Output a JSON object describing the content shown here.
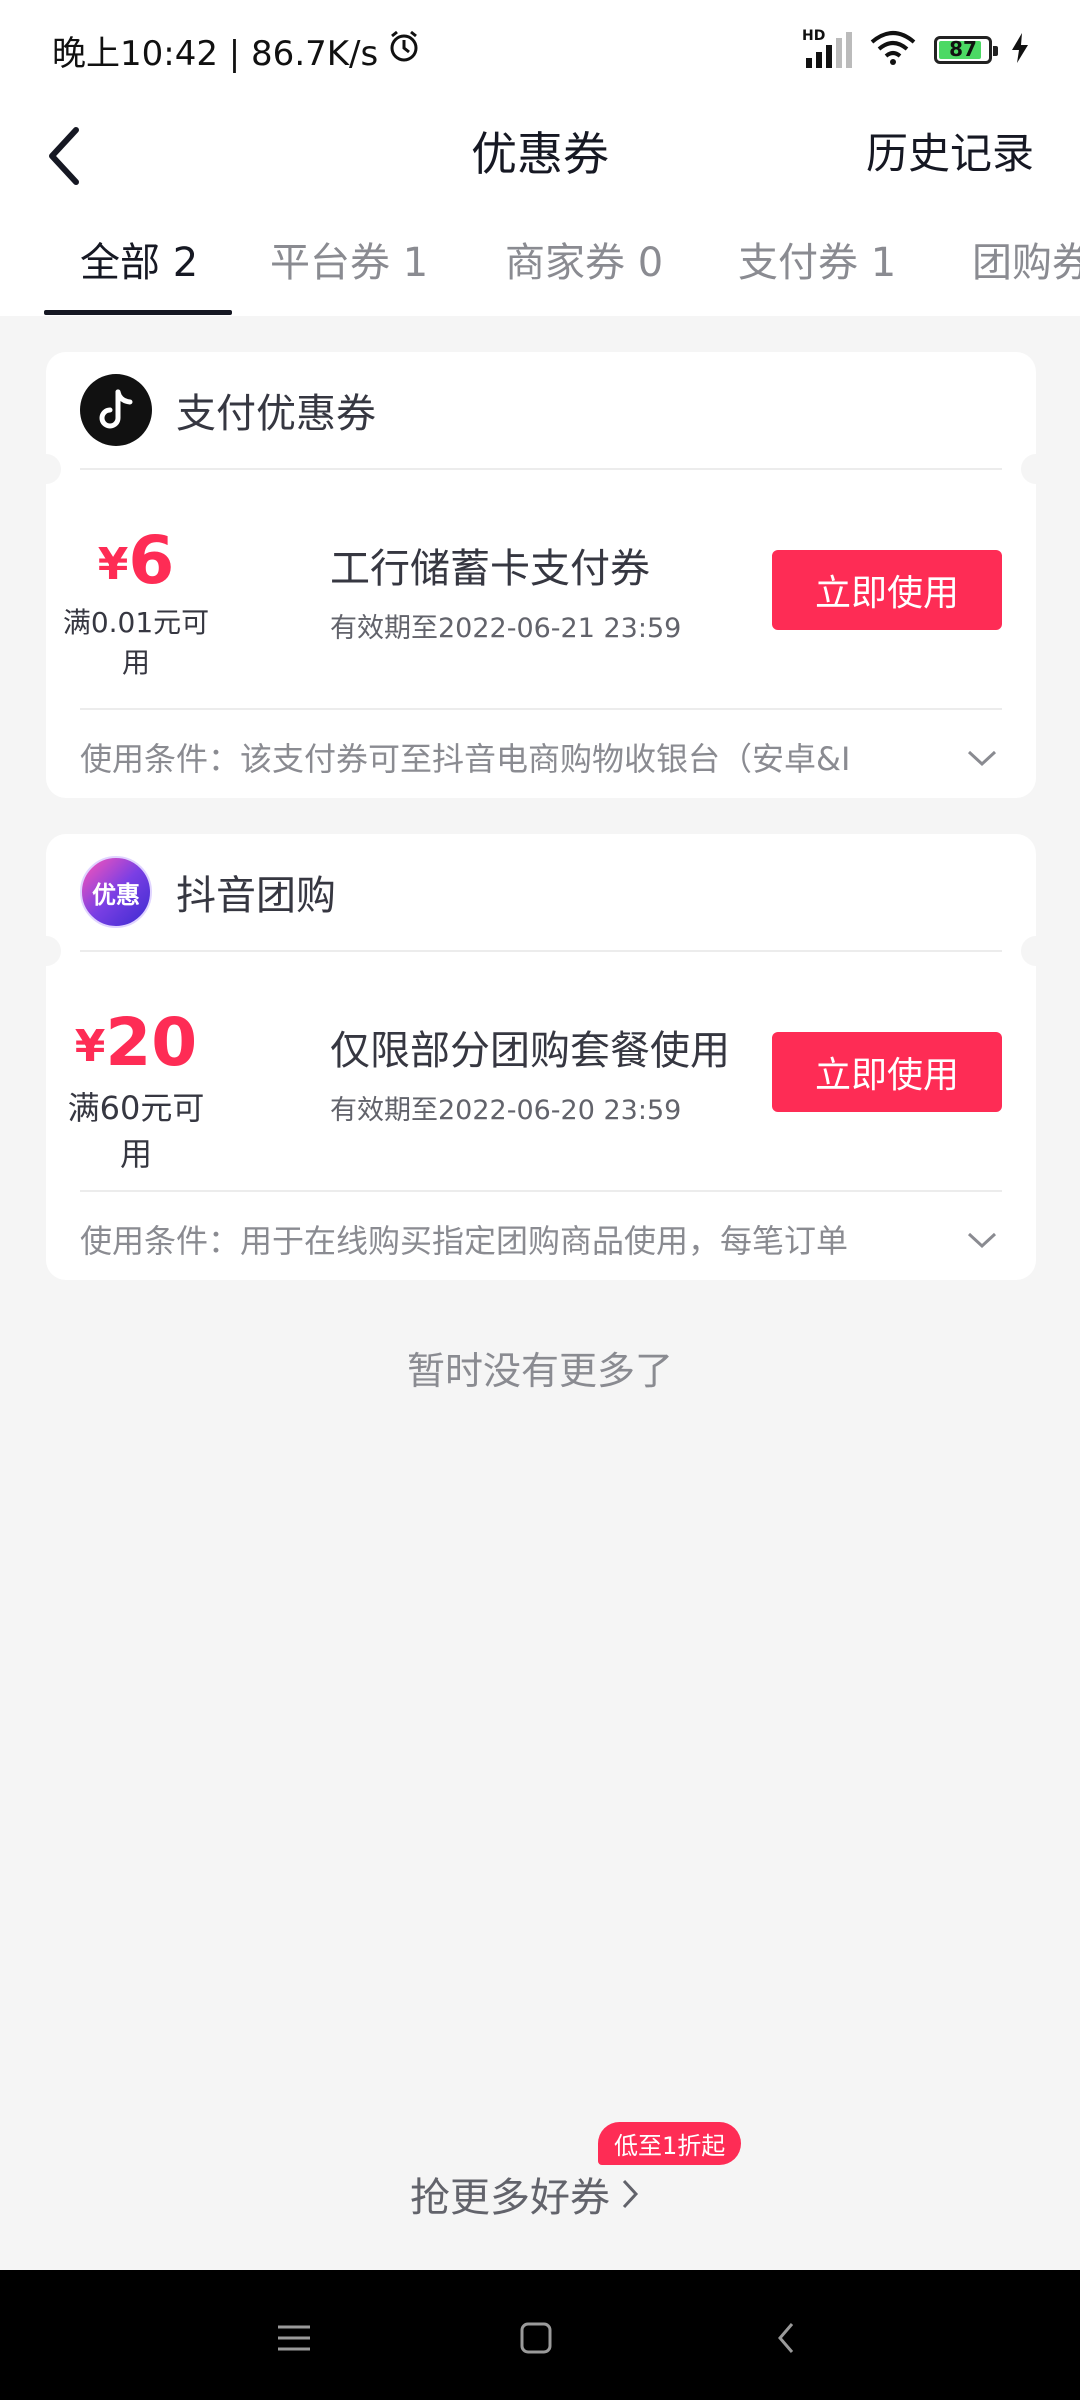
{
  "status_bar": {
    "time_text": "晚上10:42 | 86.7K/s",
    "network_label": "HD",
    "battery_level": "87"
  },
  "header": {
    "title": "优惠券",
    "history_label": "历史记录"
  },
  "tabs": [
    {
      "label": "全部 2",
      "active": true
    },
    {
      "label": "平台券 1",
      "active": false
    },
    {
      "label": "商家券 0",
      "active": false
    },
    {
      "label": "支付券 1",
      "active": false
    },
    {
      "label": "团购券",
      "active": false
    }
  ],
  "coupons": [
    {
      "section_title": "支付优惠券",
      "logo_icon": "douyin-logo-icon",
      "currency": "¥",
      "amount": "6",
      "condition": "满0.01元可用",
      "name": "工行储蓄卡支付券",
      "expiry": "有效期至2022-06-21 23:59",
      "button_label": "立即使用",
      "terms": "使用条件：该支付券可至抖音电商购物收银台（安卓&I"
    },
    {
      "section_title": "抖音团购",
      "logo_icon": "youhui-logo-icon",
      "logo_text": "优惠",
      "currency": "¥",
      "amount": "20",
      "condition": "满60元可用",
      "name": "仅限部分团购套餐使用",
      "expiry": "有效期至2022-06-20 23:59",
      "button_label": "立即使用",
      "terms": "使用条件：用于在线购买指定团购商品使用，每笔订单"
    }
  ],
  "no_more_text": "暂时没有更多了",
  "footer": {
    "more_coupons_label": "抢更多好券",
    "promo_badge": "低至1折起"
  },
  "colors": {
    "accent": "#fe2c55",
    "background": "#f5f5f5"
  }
}
